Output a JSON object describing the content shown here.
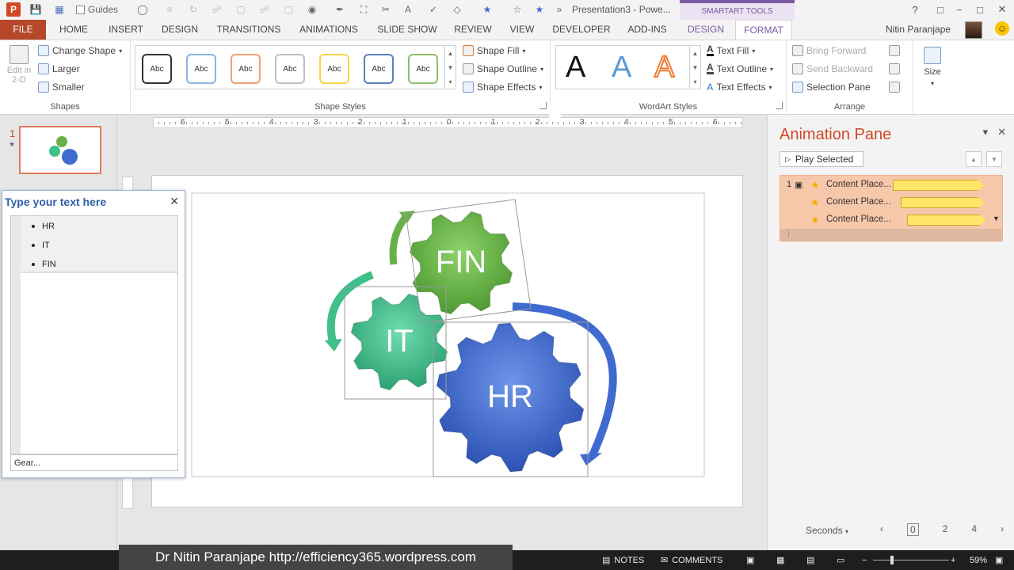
{
  "titlebar": {
    "guides_label": "Guides",
    "document_title": "Presentation3 - Powe...",
    "contextual_tab_title": "SMARTART TOOLS",
    "help": "?",
    "window_buttons": [
      "−",
      "□",
      "✕"
    ]
  },
  "tabs": {
    "file": "FILE",
    "items": [
      "HOME",
      "INSERT",
      "DESIGN",
      "TRANSITIONS",
      "ANIMATIONS",
      "SLIDE SHOW",
      "REVIEW",
      "VIEW",
      "DEVELOPER",
      "ADD-INS"
    ],
    "context_items": [
      "DESIGN",
      "FORMAT"
    ],
    "active": "FORMAT",
    "user_name": "Nitin Paranjape"
  },
  "ribbon": {
    "shapes": {
      "label": "Shapes",
      "edit_2d": "Edit in 2-D",
      "change_shape": "Change Shape",
      "larger": "Larger",
      "smaller": "Smaller"
    },
    "shape_styles": {
      "label": "Shape Styles",
      "sample_text": "Abc",
      "style_colors": [
        "#333333",
        "#8db3e2",
        "#f0a070",
        "#c0c0c0",
        "#f5d64a",
        "#5b7fbf",
        "#8fbf6a"
      ],
      "shape_fill": "Shape Fill",
      "shape_outline": "Shape Outline",
      "shape_effects": "Shape Effects"
    },
    "wordart_styles": {
      "label": "WordArt Styles",
      "letters": [
        "A",
        "A",
        "A"
      ],
      "text_fill": "Text Fill",
      "text_outline": "Text Outline",
      "text_effects": "Text Effects"
    },
    "arrange": {
      "label": "Arrange",
      "bring_forward": "Bring Forward",
      "send_backward": "Send Backward",
      "selection_pane": "Selection Pane"
    },
    "size": {
      "label": "Size"
    }
  },
  "thumbnail": {
    "slide_number": "1",
    "animation_marker": "★"
  },
  "ruler": {
    "numbers": [
      "6",
      "5",
      "4",
      "3",
      "2",
      "1",
      "0",
      "1",
      "2",
      "3",
      "4",
      "5",
      "6"
    ]
  },
  "text_pane": {
    "title": "Type your text here",
    "close": "✕",
    "items": [
      "HR",
      "IT",
      "FIN"
    ],
    "footer": "Gear..."
  },
  "smartart": {
    "gears": [
      {
        "label": "FIN",
        "color": "#6ab04a"
      },
      {
        "label": "IT",
        "color": "#3fbf8a"
      },
      {
        "label": "HR",
        "color": "#3f6bd0"
      }
    ]
  },
  "animation_pane": {
    "title": "Animation Pane",
    "play_selected": "Play Selected",
    "rows": [
      {
        "number": "1",
        "label": "Content Place..."
      },
      {
        "number": "",
        "label": "Content Place..."
      },
      {
        "number": "",
        "label": "Content Place..."
      }
    ],
    "seconds_label": "Seconds",
    "timeline": [
      "0",
      "2",
      "4"
    ]
  },
  "statusbar": {
    "watermark": "Dr Nitin Paranjape  http://efficiency365.wordpress.com",
    "notes": "NOTES",
    "comments": "COMMENTS",
    "zoom": "59%"
  }
}
